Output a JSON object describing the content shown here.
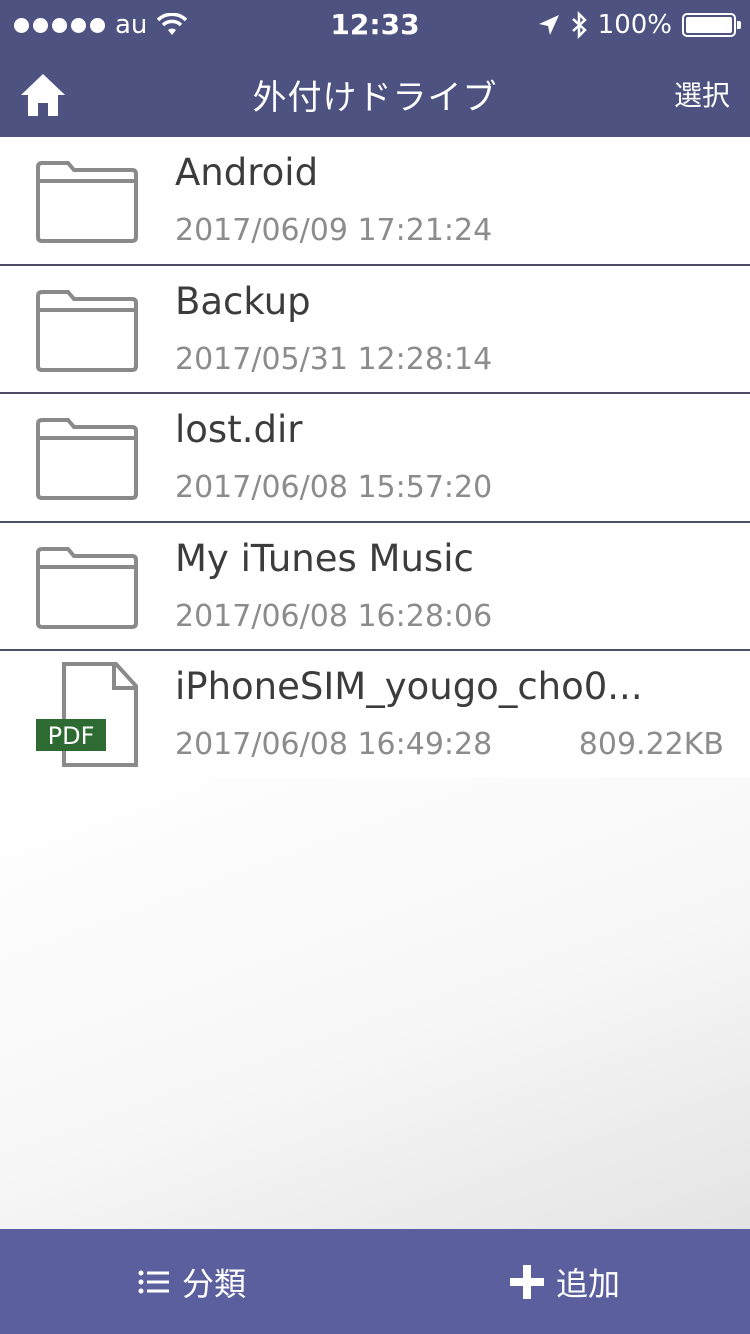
{
  "status_bar": {
    "carrier": "au",
    "time": "12:33",
    "battery": "100%"
  },
  "nav": {
    "title": "外付けドライブ",
    "select_label": "選択",
    "home_icon": "home-icon"
  },
  "files": [
    {
      "name": "Android",
      "date": "2017/06/09 17:21:24",
      "size": "",
      "type": "folder"
    },
    {
      "name": "Backup",
      "date": "2017/05/31 12:28:14",
      "size": "",
      "type": "folder"
    },
    {
      "name": "lost.dir",
      "date": "2017/06/08 15:57:20",
      "size": "",
      "type": "folder"
    },
    {
      "name": "My iTunes Music",
      "date": "2017/06/08 16:28:06",
      "size": "",
      "type": "folder"
    },
    {
      "name": "iPhoneSIM_yougo_cho0...",
      "date": "2017/06/08 16:49:28",
      "size": "809.22KB",
      "type": "pdf",
      "badge": "PDF"
    }
  ],
  "toolbar": {
    "classify_label": "分類",
    "add_label": "追加"
  },
  "colors": {
    "nav_bg": "#4e5281",
    "toolbar_bg": "#5b5f9d",
    "pdf_badge": "#2e6b33"
  }
}
